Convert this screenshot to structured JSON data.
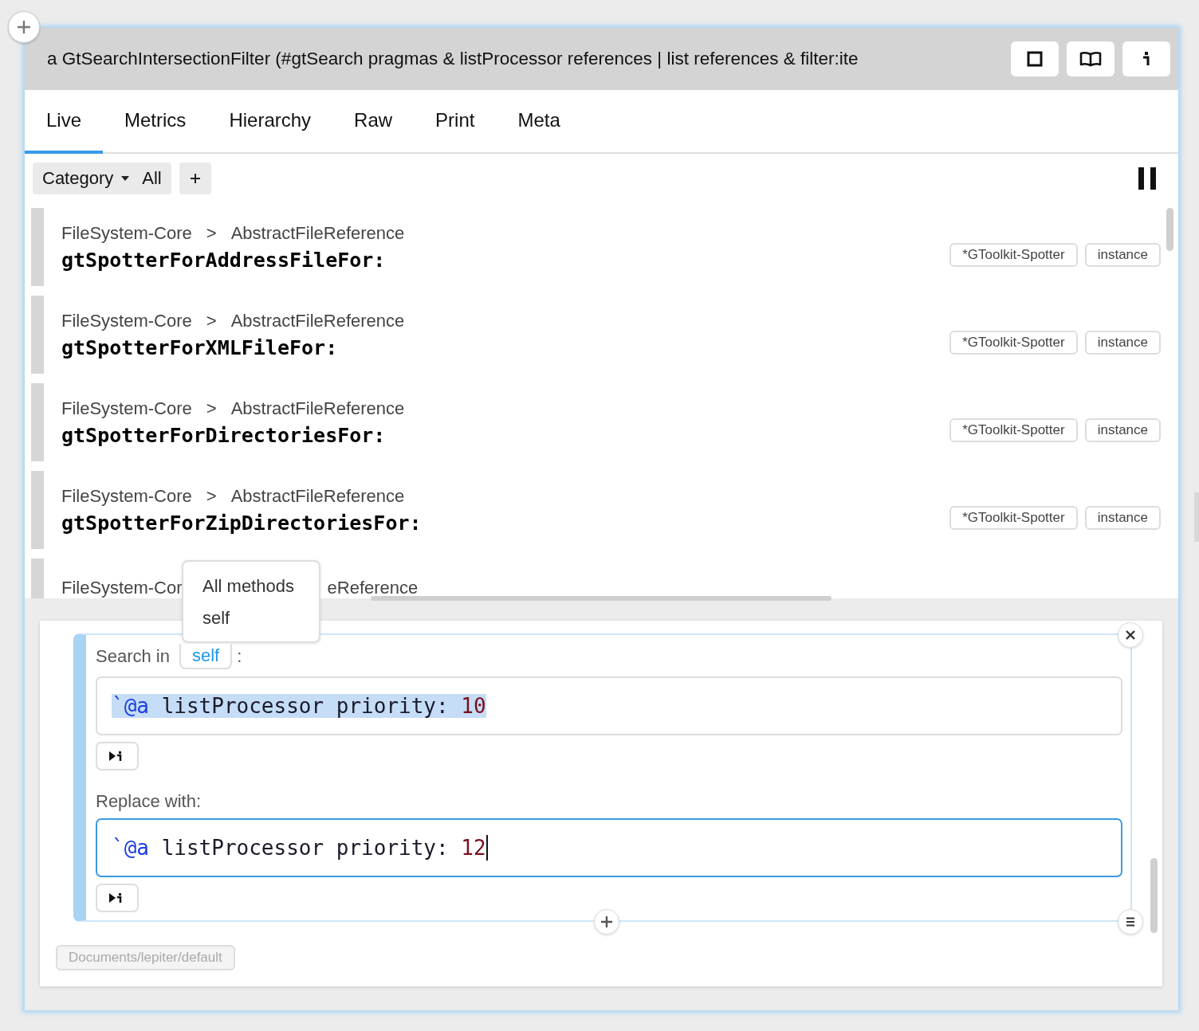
{
  "window": {
    "title": "a GtSearchIntersectionFilter (#gtSearch pragmas & listProcessor references | list references & filter:ite"
  },
  "tabs": [
    {
      "label": "Live",
      "selected": true
    },
    {
      "label": "Metrics",
      "selected": false
    },
    {
      "label": "Hierarchy",
      "selected": false
    },
    {
      "label": "Raw",
      "selected": false
    },
    {
      "label": "Print",
      "selected": false
    },
    {
      "label": "Meta",
      "selected": false
    }
  ],
  "filter": {
    "category": "Category",
    "value": "All"
  },
  "results": [
    {
      "package": "FileSystem-Core",
      "separator": ">",
      "class": "AbstractFileReference",
      "method": "gtSpotterForAddressFileFor:",
      "tags": [
        "*GToolkit-Spotter",
        "instance"
      ]
    },
    {
      "package": "FileSystem-Core",
      "separator": ">",
      "class": "AbstractFileReference",
      "method": "gtSpotterForXMLFileFor:",
      "tags": [
        "*GToolkit-Spotter",
        "instance"
      ]
    },
    {
      "package": "FileSystem-Core",
      "separator": ">",
      "class": "AbstractFileReference",
      "method": "gtSpotterForDirectoriesFor:",
      "tags": [
        "*GToolkit-Spotter",
        "instance"
      ]
    },
    {
      "package": "FileSystem-Core",
      "separator": ">",
      "class": "AbstractFileReference",
      "method": "gtSpotterForZipDirectoriesFor:",
      "tags": [
        "*GToolkit-Spotter",
        "instance"
      ]
    }
  ],
  "partial_result": {
    "package": "FileSystem-Cor",
    "class": "eReference"
  },
  "scope_menu": {
    "items": [
      {
        "label": "All methods"
      },
      {
        "label": "self"
      }
    ]
  },
  "search": {
    "label": "Search in",
    "scope": "self",
    "colon": ":",
    "selected": true,
    "tokens": [
      {
        "kind": "pattern",
        "text": "`@a"
      },
      {
        "kind": "plain",
        "text": "listProcessor priority:"
      },
      {
        "kind": "number",
        "text": "10"
      }
    ]
  },
  "replace": {
    "label": "Replace with:",
    "focused": true,
    "tokens": [
      {
        "kind": "pattern",
        "text": "`@a"
      },
      {
        "kind": "plain",
        "text": "listProcessor priority:"
      },
      {
        "kind": "number",
        "text": "12"
      }
    ]
  },
  "database": {
    "path": "Documents/lepiter/default"
  }
}
